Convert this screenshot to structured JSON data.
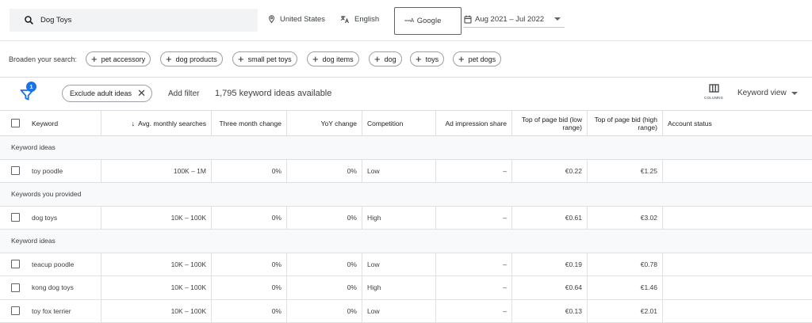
{
  "search": {
    "query": "Dog Toys"
  },
  "toolbar": {
    "location": "United States",
    "language": "English",
    "network": "Google",
    "date_range": "Aug 2021 – Jul 2022"
  },
  "broaden": {
    "label": "Broaden your search:",
    "chips": [
      "pet accessory",
      "dog products",
      "small pet toys",
      "dog items",
      "dog",
      "toys",
      "pet dogs"
    ]
  },
  "filterbar": {
    "filter_count": "1",
    "exclude_chip": "Exclude adult ideas",
    "add_filter": "Add filter",
    "ideas_count": "1,795 keyword ideas available",
    "columns_label": "COLUMNS",
    "view_label": "Keyword view"
  },
  "table": {
    "headers": {
      "keyword": "Keyword",
      "avg": "Avg. monthly searches",
      "three_month": "Three month change",
      "yoy": "YoY change",
      "competition": "Competition",
      "ad_share": "Ad impression share",
      "bid_low": "Top of page bid (low range)",
      "bid_high": "Top of page bid (high range)",
      "account": "Account status"
    },
    "groups": [
      {
        "label": "Keyword ideas",
        "rows": [
          {
            "keyword": "toy poodle",
            "avg": "100K – 1M",
            "three_month": "0%",
            "yoy": "0%",
            "competition": "Low",
            "ad_share": "–",
            "bid_low": "€0.22",
            "bid_high": "€1.25",
            "account": ""
          }
        ]
      },
      {
        "label": "Keywords you provided",
        "rows": [
          {
            "keyword": "dog toys",
            "avg": "10K – 100K",
            "three_month": "0%",
            "yoy": "0%",
            "competition": "High",
            "ad_share": "–",
            "bid_low": "€0.61",
            "bid_high": "€3.02",
            "account": ""
          }
        ]
      },
      {
        "label": "Keyword ideas",
        "rows": [
          {
            "keyword": "teacup poodle",
            "avg": "10K – 100K",
            "three_month": "0%",
            "yoy": "0%",
            "competition": "Low",
            "ad_share": "–",
            "bid_low": "€0.19",
            "bid_high": "€0.78",
            "account": ""
          },
          {
            "keyword": "kong dog toys",
            "avg": "10K – 100K",
            "three_month": "0%",
            "yoy": "0%",
            "competition": "High",
            "ad_share": "–",
            "bid_low": "€0.64",
            "bid_high": "€1.46",
            "account": ""
          },
          {
            "keyword": "toy fox terrier",
            "avg": "10K – 100K",
            "three_month": "0%",
            "yoy": "0%",
            "competition": "Low",
            "ad_share": "–",
            "bid_low": "€0.13",
            "bid_high": "€2.01",
            "account": ""
          }
        ]
      }
    ]
  },
  "icons": {
    "search": "search-icon",
    "location": "location-pin-icon",
    "language": "translate-icon",
    "network": "search-network-icon",
    "date": "calendar-icon",
    "filter": "filter-icon",
    "columns": "columns-icon"
  },
  "colors": {
    "accent": "#1a73e8",
    "group_bg": "#f8f9fa"
  }
}
